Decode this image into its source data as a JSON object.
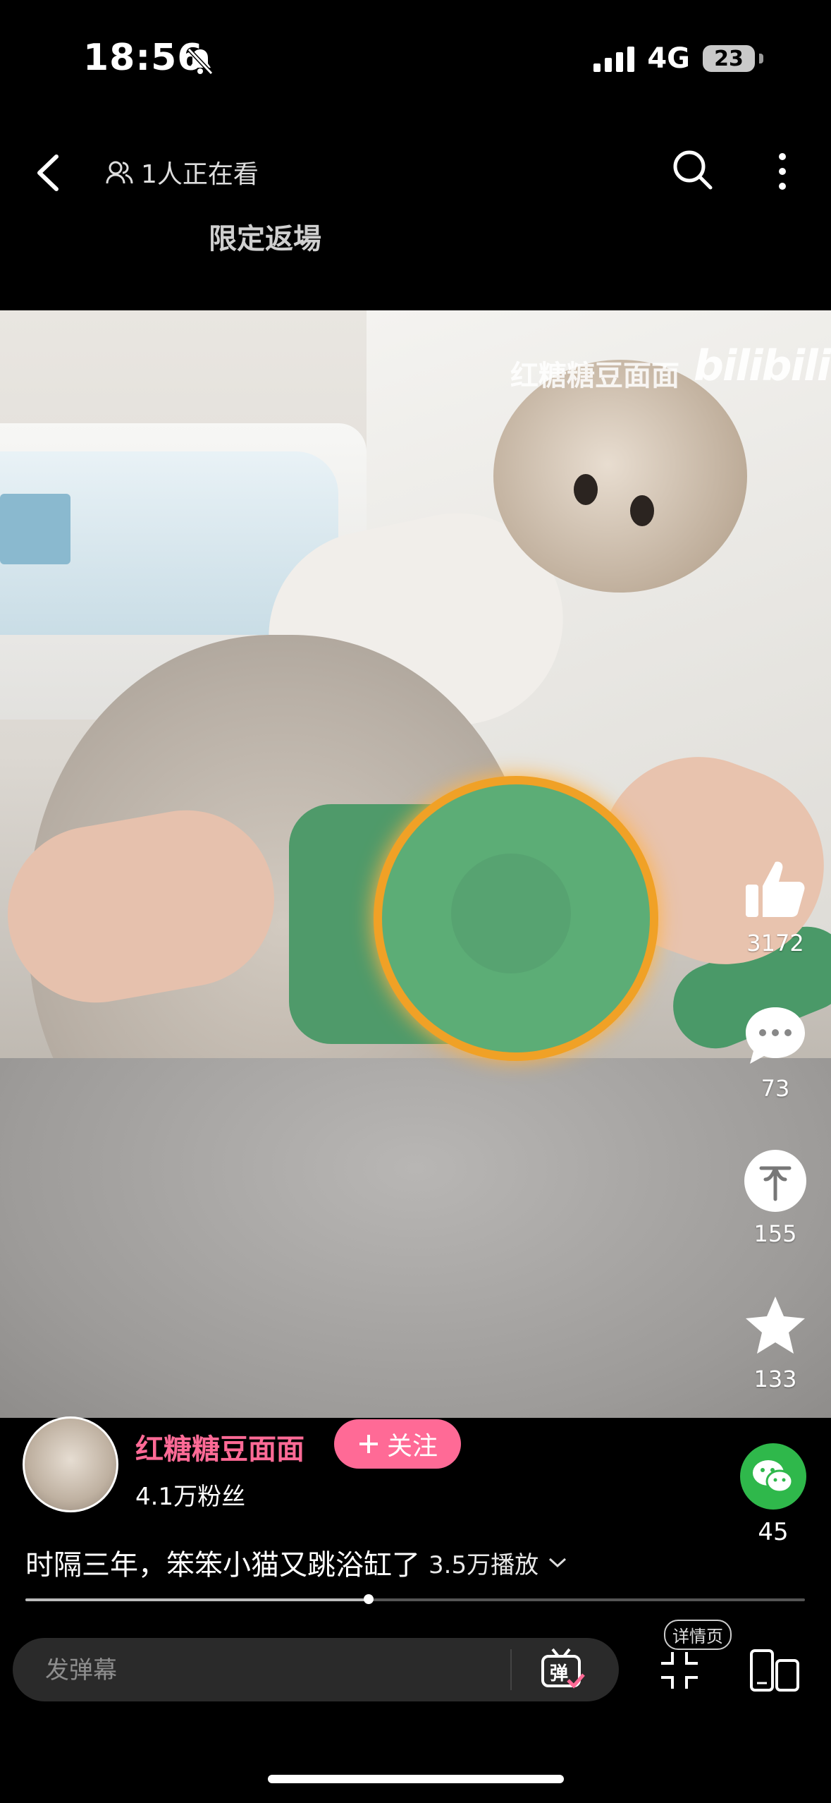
{
  "status_bar": {
    "time": "18:56",
    "network": "4G",
    "battery": "23"
  },
  "header": {
    "viewers": "1人正在看",
    "promo": "限定返場"
  },
  "video": {
    "watermark": "红糖糖豆面面",
    "watermark_logo": "bilibili"
  },
  "actions": {
    "like_count": "3172",
    "comment_count": "73",
    "coin_count": "155",
    "favorite_count": "133",
    "share_count": "45"
  },
  "author": {
    "name": "红糖糖豆面面",
    "fans": "4.1万粉丝",
    "follow_label": "关注"
  },
  "video_info": {
    "title": "时隔三年，笨笨小猫又跳浴缸了",
    "plays": "3.5万播放"
  },
  "progress": {
    "fraction": 0.44
  },
  "bottom_bar": {
    "danmaku_placeholder": "发弹幕",
    "danmaku_button": "弹",
    "detail_label": "详情页"
  },
  "colors": {
    "accent": "#ff6a96",
    "wechat": "#2fb84b"
  }
}
